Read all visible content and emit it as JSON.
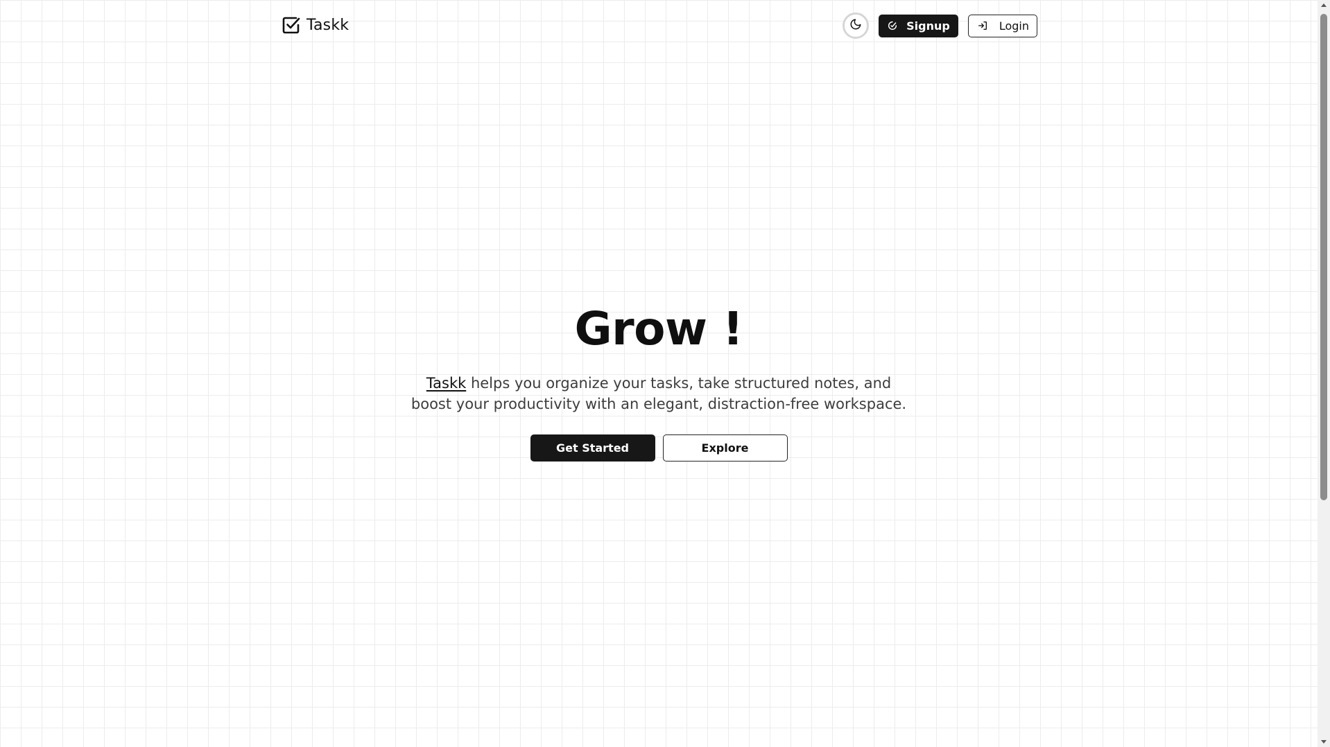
{
  "header": {
    "brand_name": "Taskk",
    "brand_icon": "checkbox-icon",
    "theme_toggle_icon": "moon-icon",
    "signup_label": "Signup",
    "signup_icon": "signup-icon",
    "login_label": "Login",
    "login_icon": "login-icon"
  },
  "hero": {
    "title": "Grow !",
    "description_brand": "Taskk",
    "description_rest": " helps you organize your tasks, take structured notes, and boost your productivity with an elegant, distraction-free workspace.",
    "primary_button": "Get Started",
    "secondary_button": "Explore"
  },
  "colors": {
    "primary": "#171717",
    "background": "#ffffff",
    "grid_line": "#ececec",
    "text_muted": "#3d3d3d"
  }
}
